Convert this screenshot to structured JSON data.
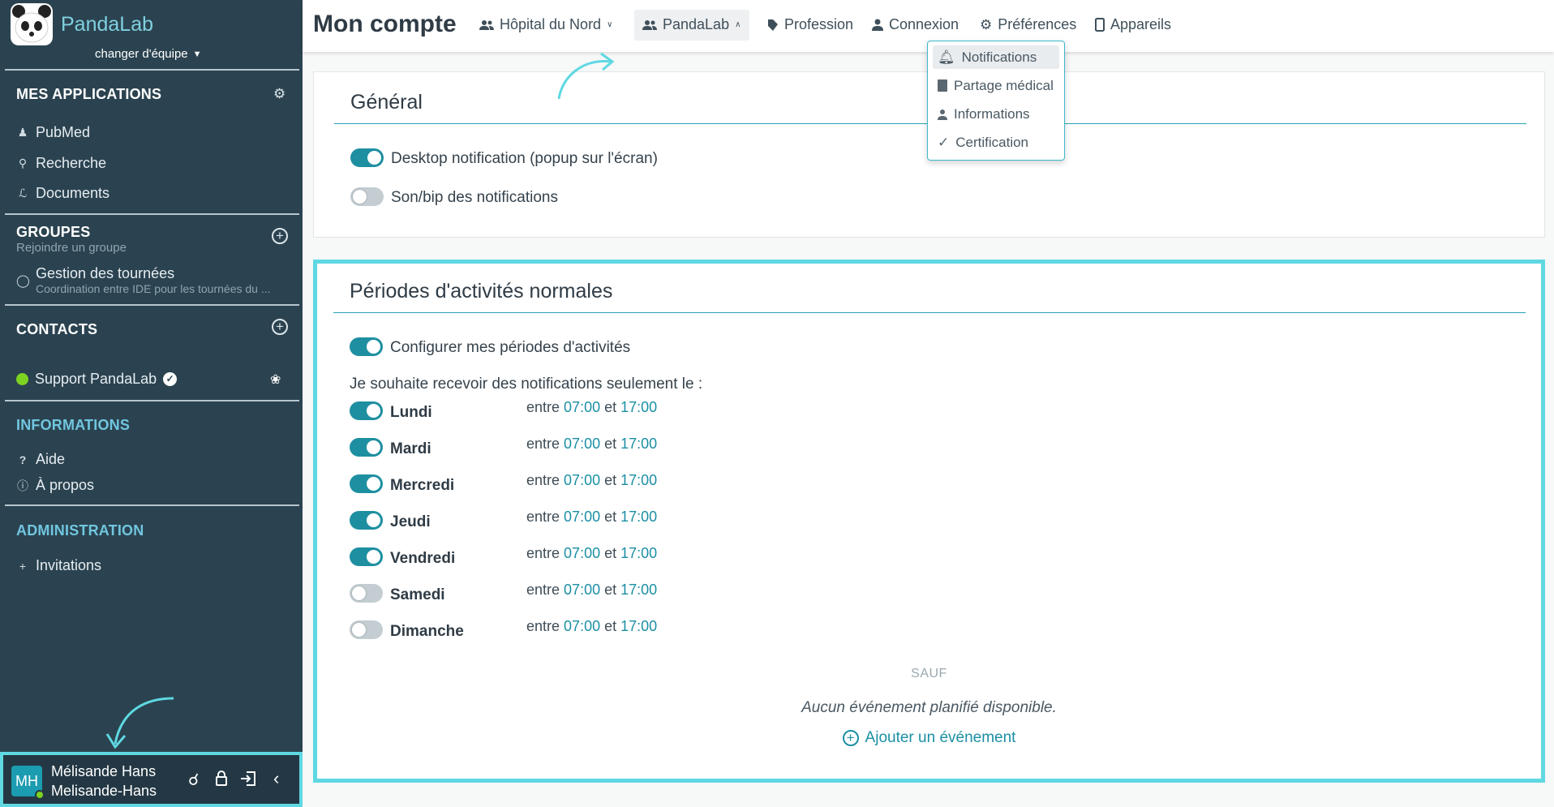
{
  "app": {
    "name": "PandaLab",
    "change_team": "changer d'équipe"
  },
  "sidebar": {
    "apps": {
      "title": "MES APPLICATIONS",
      "items": [
        {
          "label": "PubMed",
          "icon": "user-doctor-icon"
        },
        {
          "label": "Recherche",
          "icon": "search-icon"
        },
        {
          "label": "Documents",
          "icon": "paperclip-icon"
        }
      ]
    },
    "groups": {
      "title": "GROUPES",
      "subtitle": "Rejoindre un groupe",
      "item": {
        "label": "Gestion des tournées",
        "desc": "Coordination entre IDE pour les tournées du ..."
      }
    },
    "contacts": {
      "title": "CONTACTS",
      "item": {
        "label": "Support PandaLab",
        "status": "online"
      }
    },
    "info": {
      "title": "INFORMATIONS",
      "items": [
        {
          "label": "Aide",
          "icon": "question-icon"
        },
        {
          "label": "À propos",
          "icon": "info-icon"
        }
      ]
    },
    "admin": {
      "title": "ADMINISTRATION",
      "items": [
        {
          "label": "Invitations",
          "icon": "plus-icon"
        }
      ]
    }
  },
  "user": {
    "initials": "MH",
    "name": "Mélisande Hans",
    "username": "Melisande-Hans"
  },
  "header": {
    "title": "Mon compte",
    "nav": [
      {
        "label": "Hôpital du Nord",
        "icon": "users-icon"
      },
      {
        "label": "PandaLab",
        "icon": "users-icon"
      },
      {
        "label": "Profession",
        "icon": "stethoscope-icon"
      },
      {
        "label": "Connexion",
        "icon": "user-icon"
      },
      {
        "label": "Préférences",
        "icon": "gear-icon"
      },
      {
        "label": "Appareils",
        "icon": "mobile-icon"
      }
    ]
  },
  "dropdown": {
    "items": [
      {
        "label": "Notifications",
        "icon": "bell-icon"
      },
      {
        "label": "Partage médical",
        "icon": "file-icon"
      },
      {
        "label": "Informations",
        "icon": "user-icon"
      },
      {
        "label": "Certification",
        "icon": "check-icon"
      }
    ]
  },
  "general": {
    "title": "Général",
    "options": [
      {
        "label": "Desktop notification (popup sur l'écran)",
        "on": true
      },
      {
        "label": "Son/bip des notifications",
        "on": false
      }
    ]
  },
  "periods": {
    "title": "Périodes d'activités normales",
    "configure": "Configurer mes périodes d'activités",
    "intro": "Je souhaite recevoir des notifications seulement le :",
    "days": [
      {
        "name": "Lundi",
        "on": true,
        "from": "07:00",
        "to": "17:00"
      },
      {
        "name": "Mardi",
        "on": true,
        "from": "07:00",
        "to": "17:00"
      },
      {
        "name": "Mercredi",
        "on": true,
        "from": "07:00",
        "to": "17:00"
      },
      {
        "name": "Jeudi",
        "on": true,
        "from": "07:00",
        "to": "17:00"
      },
      {
        "name": "Vendredi",
        "on": true,
        "from": "07:00",
        "to": "17:00"
      },
      {
        "name": "Samedi",
        "on": false,
        "from": "07:00",
        "to": "17:00"
      },
      {
        "name": "Dimanche",
        "on": false,
        "from": "07:00",
        "to": "17:00"
      }
    ],
    "between": "entre",
    "and": "et",
    "except": "SAUF",
    "no_event": "Aucun événement planifié disponible.",
    "add_event": "Ajouter un événement"
  },
  "colors": {
    "sidebar": "#2b4350",
    "accent": "#1e8fa1",
    "highlight": "#5fd8e2"
  }
}
